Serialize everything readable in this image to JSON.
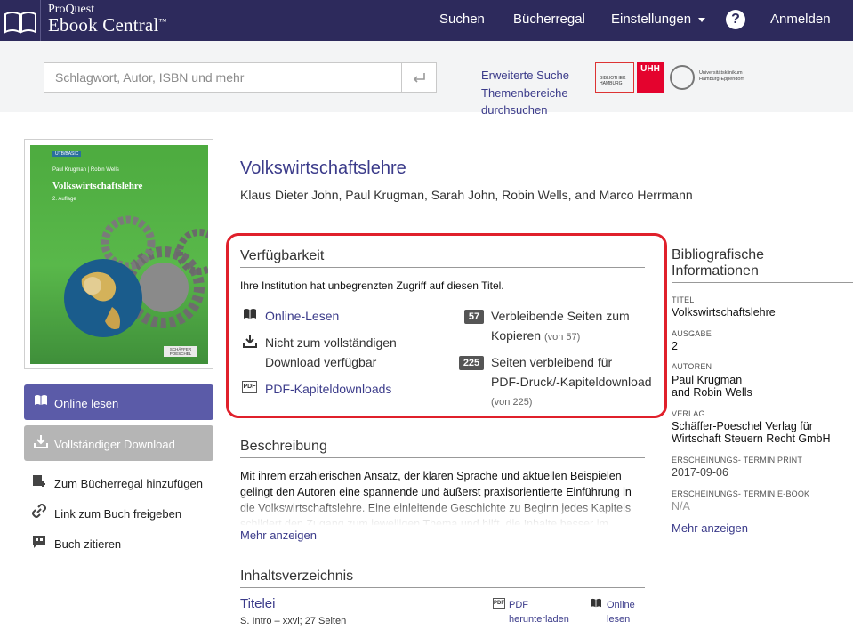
{
  "header": {
    "brand_top": "ProQuest",
    "brand_main": "Ebook Central",
    "brand_tm": "™",
    "nav": {
      "search": "Suchen",
      "bookshelf": "Bücherregal",
      "settings": "Einstellungen",
      "login": "Anmelden"
    }
  },
  "searchbar": {
    "placeholder": "Schlagwort, Autor, ISBN und mehr",
    "advanced": "Erweiterte Suche",
    "browse_line1": "Themenbereiche",
    "browse_line2": "durchsuchen",
    "inst_logo_text": "BIBLIOTHEK HAMBURG",
    "uhh_text": "UHH",
    "uke_text": "Universitätsklinikum Hamburg-Eppendorf"
  },
  "cover": {
    "publisher_tag": "UTB/BASIC",
    "authors": "Paul Krugman | Robin Wells",
    "title": "Volkswirtschaftslehre",
    "edition": "2. Auflage",
    "publisher_logo": "SCHÄFFER POESCHEL"
  },
  "left_actions": {
    "read_online": "Online lesen",
    "full_download": "Vollständiger Download",
    "add_bookshelf": "Zum Bücherregal hinzufügen",
    "share_link": "Link zum Buch freigeben",
    "cite": "Buch zitieren"
  },
  "book": {
    "title": "Volkswirtschaftslehre",
    "authors": "Klaus Dieter John, Paul Krugman, Sarah John, Robin Wells, and Marco Herrmann"
  },
  "availability": {
    "heading": "Verfügbarkeit",
    "note": "Ihre Institution hat unbegrenzten Zugriff auf diesen Titel.",
    "read_online": "Online-Lesen",
    "no_download_line1": "Nicht zum vollständigen",
    "no_download_line2": "Download verfügbar",
    "pdf_chapters": "PDF-Kapiteldownloads",
    "copy_count": "57",
    "copy_line1": "Verbleibende Seiten zum",
    "copy_line2": "Kopieren",
    "copy_of": "(von 57)",
    "print_count": "225",
    "print_line1": "Seiten verbleibend für",
    "print_line2": "PDF-Druck/-Kapiteldownload",
    "print_of": "(von 225)"
  },
  "description": {
    "heading": "Beschreibung",
    "text": "Mit ihrem erzählerischen Ansatz, der klaren Sprache und aktuellen Beispielen gelingt den Autoren eine spannende und äußerst praxisorientierte Einführung in die Volkswirtschaftslehre. Eine einleitende Geschichte zu Beginn jedes Kapitels schildert den Zugang zum jeweiligen Thema und hilft, die Inhalte besser im",
    "more": "Mehr anzeigen"
  },
  "bibliography": {
    "heading_line1": "Bibliografische",
    "heading_line2": "Informationen",
    "title_label": "TITEL",
    "title_value": "Volkswirtschaftslehre",
    "edition_label": "AUSGABE",
    "edition_value": "2",
    "authors_label": "AUTOREN",
    "authors_line1": "Paul Krugman",
    "authors_line2": "and Robin Wells",
    "publisher_label": "VERLAG",
    "publisher_line1": "Schäffer-Poeschel Verlag für",
    "publisher_line2": "Wirtschaft Steuern Recht GmbH",
    "print_date_label": "ERSCHEINUNGS- TERMIN PRINT",
    "print_date_value": "2017-09-06",
    "ebook_date_label": "ERSCHEINUNGS- TERMIN E-BOOK",
    "ebook_date_value": "N/A",
    "more": "Mehr anzeigen"
  },
  "toc": {
    "heading": "Inhaltsverzeichnis",
    "first_title": "Titelei",
    "first_sub": "S. Intro – xxvi; 27 Seiten",
    "pdf_line1": "PDF",
    "pdf_line2": "herunterladen",
    "online_line1": "Online",
    "online_line2": "lesen"
  },
  "colors": {
    "navy": "#2d2a5c",
    "link": "#3b3b8a",
    "primary_button": "#5b5ba8",
    "highlight_red": "#e0202b"
  }
}
